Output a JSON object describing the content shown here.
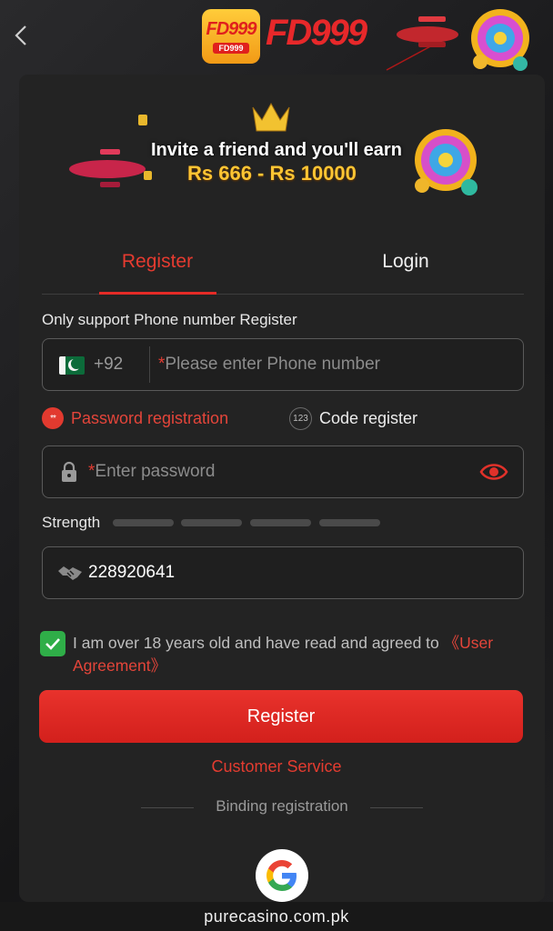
{
  "brand": {
    "badge_big": "FD999",
    "badge_small": "FD999",
    "logo_text": "FD999"
  },
  "banner": {
    "line1": "Invite a friend and you'll earn",
    "line2": "Rs 666 - Rs 10000"
  },
  "tabs": [
    {
      "label": "Register",
      "active": true
    },
    {
      "label": "Login",
      "active": false
    }
  ],
  "form": {
    "support_text": "Only support Phone number Register",
    "country_code": "+92",
    "phone_placeholder": "Please enter Phone number",
    "mode_password_label": "Password registration",
    "mode_password_icon_text": "**",
    "mode_code_label": "Code register",
    "mode_code_icon_text": "123",
    "password_placeholder": "Enter password",
    "required_mark": "*",
    "strength_label": "Strength",
    "strength_segments": 4,
    "invite_code": "228920641",
    "agree_text": "I am over 18 years old and have read and agreed to ",
    "agree_link": "《User Agreement》",
    "agree_checked": true
  },
  "buttons": {
    "register_label": "Register",
    "customer_service": "Customer Service",
    "binding_registration": "Binding registration"
  },
  "footer": {
    "domain": "purecasino.com.pk"
  },
  "icons": {
    "back": "chevron-left-icon",
    "flag": "pakistan-flag-icon",
    "lock": "lock-icon",
    "eye": "eye-icon",
    "invite": "handshake-icon",
    "check": "checkmark-icon",
    "google": "google-icon"
  },
  "colors": {
    "accent": "#e42b27",
    "background": "#1c1c1e",
    "card": "#232323",
    "check": "#2fae48",
    "gold": "#ffc533"
  }
}
